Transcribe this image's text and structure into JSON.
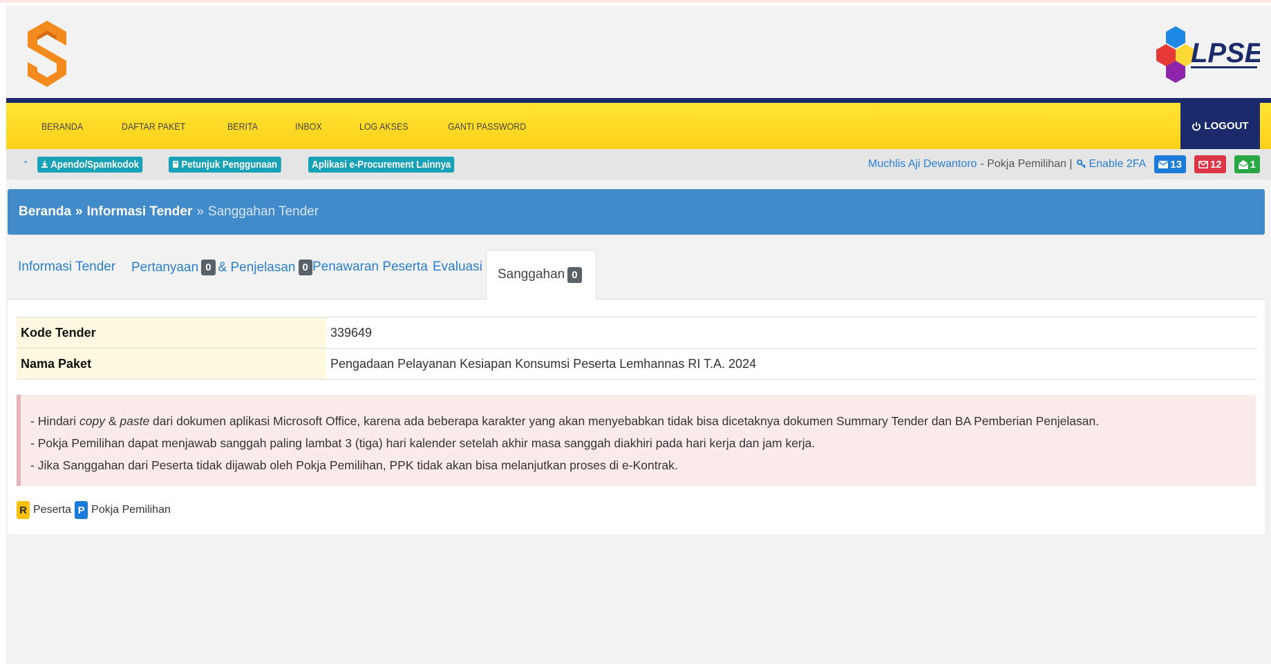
{
  "nav": {
    "items": [
      "BERANDA",
      "DAFTAR PAKET",
      "BERITA",
      "INBOX",
      "LOG AKSES",
      "GANTI PASSWORD"
    ],
    "logout_label": "LOGOUT"
  },
  "toolbar": {
    "buttons": [
      "Apendo/Spamkodok",
      "Petunjuk Penggunaan",
      "Aplikasi e-Procurement Lainnya"
    ],
    "user_name": "Muchlis Aji Dewantoro",
    "user_role": "- Pokja Pemilihan |",
    "enable_2fa": "Enable 2FA",
    "badges": [
      {
        "value": "13",
        "color": "#1a7bd9",
        "icon": "envelope-icon"
      },
      {
        "value": "12",
        "color": "#dc3545",
        "icon": "envelope-open-icon"
      },
      {
        "value": "1",
        "color": "#28a745",
        "icon": "envelope-open-icon"
      }
    ]
  },
  "breadcrumb": {
    "home": "Beranda",
    "separator": "»",
    "parent": "Informasi Tender",
    "current": "Sanggahan Tender"
  },
  "tabs": {
    "informasi": "Informasi Tender",
    "pertanyaan": "Pertanyaan",
    "pertanyaan_count": "0",
    "penjelasan": "& Penjelasan",
    "penjelasan_count": "0",
    "penawaran": "Penawaran Peserta",
    "evaluasi": "Evaluasi",
    "sanggahan": "Sanggahan",
    "sanggahan_count": "0"
  },
  "info": {
    "kode_label": "Kode Tender",
    "kode_value": "339649",
    "nama_label": "Nama Paket",
    "nama_value": "Pengadaan Pelayanan Kesiapan Konsumsi Peserta Lemhannas RI T.A. 2024"
  },
  "notice": {
    "line1_prefix": "- Hindari ",
    "line1_em1": "copy",
    "line1_amp": " & ",
    "line1_em2": "paste",
    "line1_suffix": " dari dokumen aplikasi Microsoft Office, karena ada beberapa karakter yang akan menyebabkan tidak bisa dicetaknya dokumen Summary Tender dan BA Pemberian Penjelasan.",
    "line2": "- Pokja Pemilihan dapat menjawab sanggah paling lambat 3 (tiga) hari kalender setelah akhir masa sanggah diakhiri pada hari kerja dan jam kerja.",
    "line3": "- Jika Sanggahan dari Peserta tidak dijawab oleh Pokja Pemilihan, PPK tidak akan bisa melanjutkan proses di e-Kontrak."
  },
  "legend": {
    "r_badge": "R",
    "r_label": "Peserta",
    "p_badge": "P",
    "p_label": "Pokja Pemilihan"
  }
}
